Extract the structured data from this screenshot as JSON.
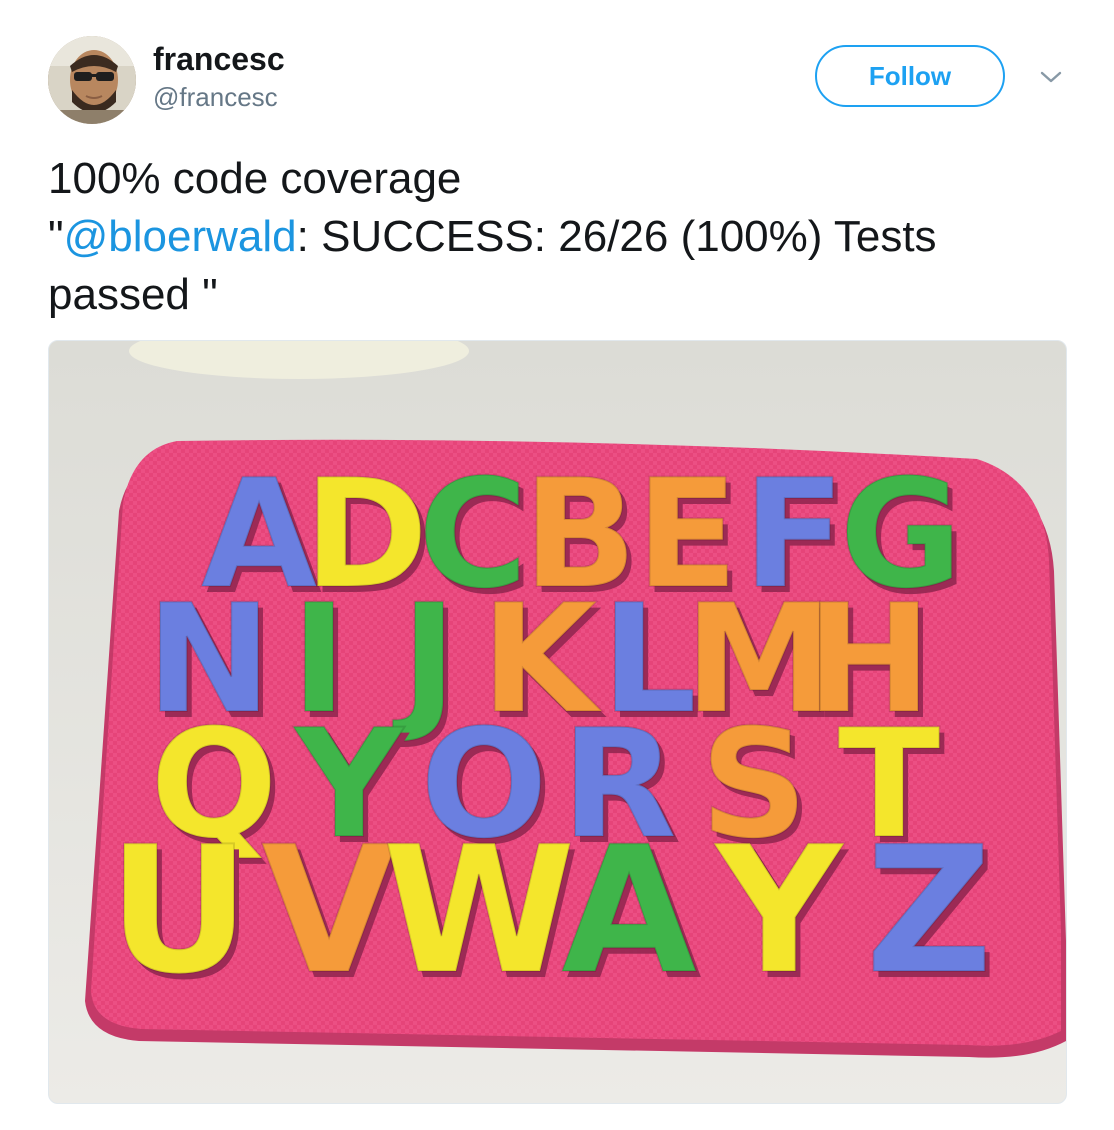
{
  "user": {
    "display_name": "francesc",
    "handle": "@francesc"
  },
  "actions": {
    "follow_label": "Follow"
  },
  "tweet": {
    "line1": "100% code coverage",
    "quote_open": "\"",
    "mention": "@bloerwald",
    "rest": ": SUCCESS: 26/26 (100%) Tests passed \""
  },
  "media": {
    "subject": "foam alphabet puzzle",
    "letters": [
      {
        "ch": "A",
        "color": "#6b7fe0"
      },
      {
        "ch": "D",
        "color": "#f4e62c"
      },
      {
        "ch": "C",
        "color": "#3fb54a"
      },
      {
        "ch": "B",
        "color": "#f59b3a"
      },
      {
        "ch": "E",
        "color": "#f59b3a"
      },
      {
        "ch": "F",
        "color": "#6b7fe0"
      },
      {
        "ch": "G",
        "color": "#3fb54a"
      },
      {
        "ch": "N",
        "color": "#6b7fe0"
      },
      {
        "ch": "I",
        "color": "#3fb54a"
      },
      {
        "ch": "J",
        "color": "#3fb54a"
      },
      {
        "ch": "K",
        "color": "#f59b3a"
      },
      {
        "ch": "L",
        "color": "#6b7fe0"
      },
      {
        "ch": "M",
        "color": "#f59b3a"
      },
      {
        "ch": "H",
        "color": "#f59b3a"
      },
      {
        "ch": "Q",
        "color": "#f4e62c"
      },
      {
        "ch": "Y",
        "color": "#3fb54a"
      },
      {
        "ch": "O",
        "color": "#6b7fe0"
      },
      {
        "ch": "R",
        "color": "#6b7fe0"
      },
      {
        "ch": "S",
        "color": "#f59b3a"
      },
      {
        "ch": "T",
        "color": "#f4e62c"
      },
      {
        "ch": "U",
        "color": "#f4e62c"
      },
      {
        "ch": "V",
        "color": "#f59b3a"
      },
      {
        "ch": "W",
        "color": "#f4e62c"
      },
      {
        "ch": "A",
        "color": "#3fb54a"
      },
      {
        "ch": "Y",
        "color": "#f4e62c"
      },
      {
        "ch": "Z",
        "color": "#6b7fe0"
      }
    ],
    "mat_color": "#ec4f84"
  },
  "colors": {
    "accent": "#1da1f2",
    "mention": "#1b95e0",
    "text": "#14171a",
    "secondary": "#657786"
  }
}
